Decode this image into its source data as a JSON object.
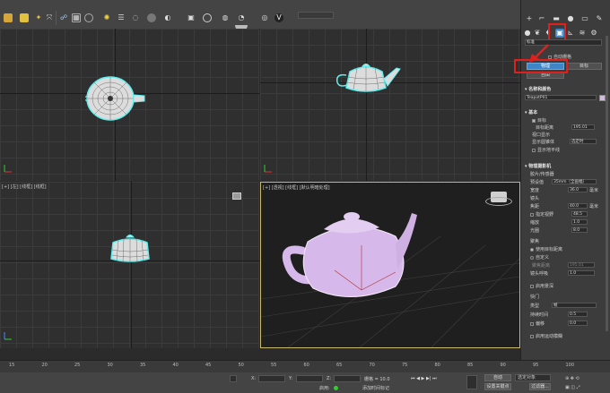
{
  "toolbar": {
    "icons": [
      "create-icon",
      "light-icon",
      "selection-icon",
      "move-icon",
      "scale-icon",
      "material-icon",
      "camera-icon",
      "sun-icon",
      "render-icon",
      "color-icon",
      "teapot-icon",
      "render-setup-icon",
      "render-frame-icon",
      "render-production-icon",
      "lock-icon",
      "viewport-icon",
      "settings-icon"
    ]
  },
  "viewports": {
    "top_right_label": "",
    "bottom_left_label": "[+] [左] [线框] [线框]",
    "perspective_label": "[+] [透视] [线框] [默认明暗处理]"
  },
  "panel": {
    "tab_icons": [
      "geometry-icon",
      "shapes-icon",
      "lights-icon",
      "cameras-icon",
      "helpers-icon",
      "spacewarps-icon",
      "systems-icon"
    ],
    "dropdown": "标准",
    "auto_grid_label": "自动栅格",
    "btn_physical": "物理",
    "btn_target": "目标",
    "btn_free": "自由",
    "section_name_color": "名称和颜色",
    "object_name": "TeapotP01",
    "section_basic": "基本",
    "target_label": "目标",
    "target_distance_label": "目标距离",
    "target_distance_value": "195.01",
    "viewport_display_label": "视口显示",
    "show_cone_label": "显示圆锥体",
    "show_cone_value": "选定时",
    "show_horizon_label": "显示地平线",
    "section_physical_camera": "物理摄影机",
    "film_sensor_label": "胶片/传感器",
    "preset_label": "预设值",
    "preset_value": "35mm（全画幅）",
    "width_label": "宽度",
    "width_value": "36.0",
    "width_unit": "毫米",
    "lens_label": "镜头",
    "focal_label": "焦距",
    "focal_value": "40.0",
    "focal_unit": "毫米",
    "fov_label": "指定视野",
    "fov_value": "48.5",
    "zoom_label": "缩放",
    "zoom_value": "1.0",
    "aperture_label": "光圈",
    "aperture_value": "8.0",
    "focus_section": "聚焦",
    "use_target_label": "使用目标距离",
    "custom_label": "自定义",
    "focus_distance_label": "聚焦距离",
    "focus_distance_value": "195.01",
    "lens_breathing_label": "镜头呼吸",
    "lens_breathing_value": "1.0",
    "enable_dof_label": "启用景深",
    "shutter_section": "快门",
    "type_label": "类型",
    "type_value": "帧",
    "duration_label": "持续时间",
    "duration_value": "0.5",
    "offset_label": "偏移",
    "offset_value": "0.0",
    "motion_blur_label": "启用运动模糊"
  },
  "timeline": {
    "ticks": [
      "15",
      "20",
      "25",
      "30",
      "35",
      "40",
      "45",
      "50",
      "55",
      "60",
      "65",
      "70",
      "75",
      "80",
      "85",
      "90",
      "95",
      "100"
    ]
  },
  "status": {
    "x_label": "X:",
    "y_label": "Y:",
    "z_label": "Z:",
    "grid_label": "栅格 = 10.0",
    "enabled_label": "启用:",
    "add_time_tag": "添加时间标记",
    "auto_label": "自动",
    "set_key_label": "设置关键点",
    "selection_value": "选定对象",
    "key_filter_label": "过滤器..."
  },
  "colors": {
    "teapot_wire": "#5ef0f0",
    "teapot_shaded": "#d7b8ea",
    "highlight": "#e0201d",
    "active_button": "#3f86c9"
  }
}
